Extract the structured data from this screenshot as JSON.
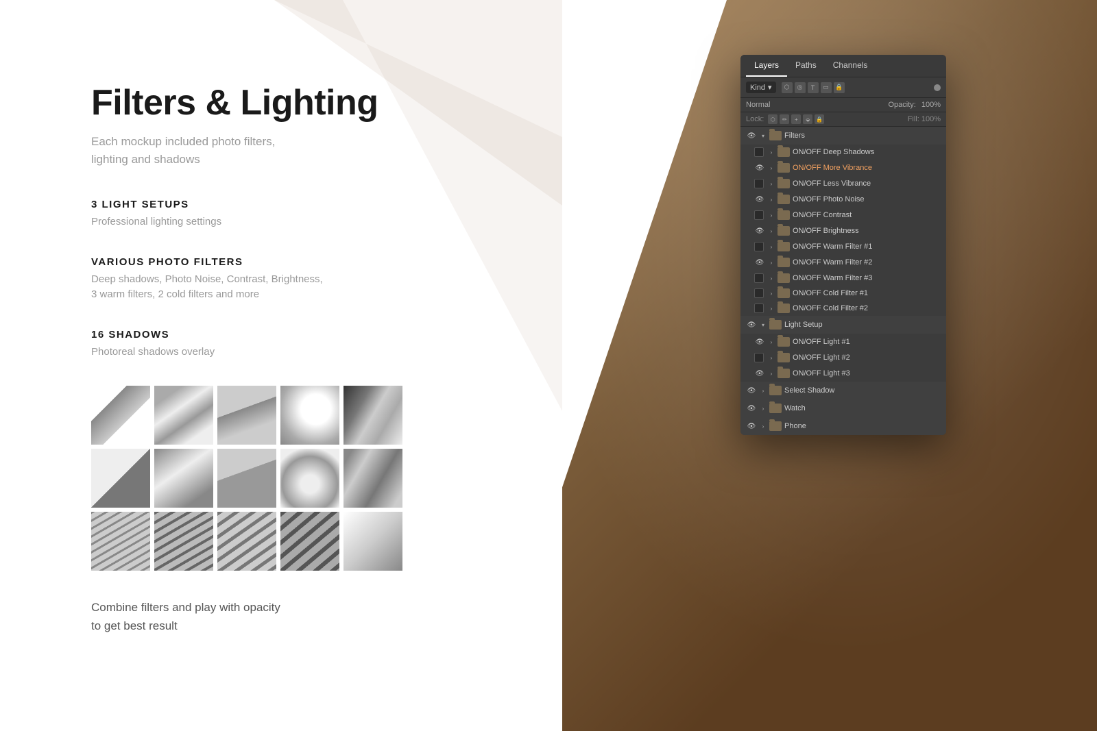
{
  "page": {
    "bg_color": "#ffffff"
  },
  "content": {
    "main_title": "Filters & Lighting",
    "subtitle_line1": "Each mockup included photo filters,",
    "subtitle_line2": "lighting and shadows",
    "section1": {
      "heading": "3 LIGHT SETUPS",
      "desc": "Professional lighting settings"
    },
    "section2": {
      "heading": "VARIOUS PHOTO FILTERS",
      "desc_line1": "Deep shadows, Photo Noise, Contrast, Brightness,",
      "desc_line2": "3 warm filters, 2 cold filters and more"
    },
    "section3": {
      "heading": "16 SHADOWS",
      "desc": "Photoreal shadows overlay"
    },
    "combine_text_line1": "Combine filters and play with opacity",
    "combine_text_line2": "to get best result"
  },
  "ps_panel": {
    "tabs": [
      "Layers",
      "Paths",
      "Channels"
    ],
    "active_tab": "Layers",
    "kind_label": "Kind",
    "blend_mode": "Normal",
    "opacity_label": "Opacity:",
    "opacity_value": "100",
    "lock_label": "Lock:",
    "fill_label": "Fill:",
    "layers": [
      {
        "type": "group",
        "name": "Filters",
        "visible": true,
        "expanded": true,
        "children": [
          {
            "name": "ON/OFF Deep Shadows",
            "visible": false
          },
          {
            "name": "ON/OFF More Vibrance",
            "visible": true,
            "highlight": true
          },
          {
            "name": "ON/OFF Less Vibrance",
            "visible": false
          },
          {
            "name": "ON/OFF Photo Noise",
            "visible": true
          },
          {
            "name": "ON/OFF Contrast",
            "visible": false
          },
          {
            "name": "ON/OFF Brightness",
            "visible": true
          },
          {
            "name": "ON/OFF Warm Filter #1",
            "visible": false
          },
          {
            "name": "ON/OFF Warm Filter #2",
            "visible": true
          },
          {
            "name": "ON/OFF Warm Filter #3",
            "visible": false
          },
          {
            "name": "ON/OFF Cold Filter #1",
            "visible": false
          },
          {
            "name": "ON/OFF Cold Filter #2",
            "visible": false
          }
        ]
      },
      {
        "type": "group",
        "name": "Light Setup",
        "visible": true,
        "expanded": true,
        "children": [
          {
            "name": "ON/OFF Light #1",
            "visible": true
          },
          {
            "name": "ON/OFF Light #2",
            "visible": false
          },
          {
            "name": "ON/OFF Light #3",
            "visible": true
          }
        ]
      },
      {
        "type": "group",
        "name": "Select Shadow",
        "visible": true,
        "expanded": false
      },
      {
        "type": "group",
        "name": "Watch",
        "visible": true,
        "expanded": false
      },
      {
        "type": "group",
        "name": "Phone",
        "visible": true,
        "expanded": false
      }
    ]
  }
}
